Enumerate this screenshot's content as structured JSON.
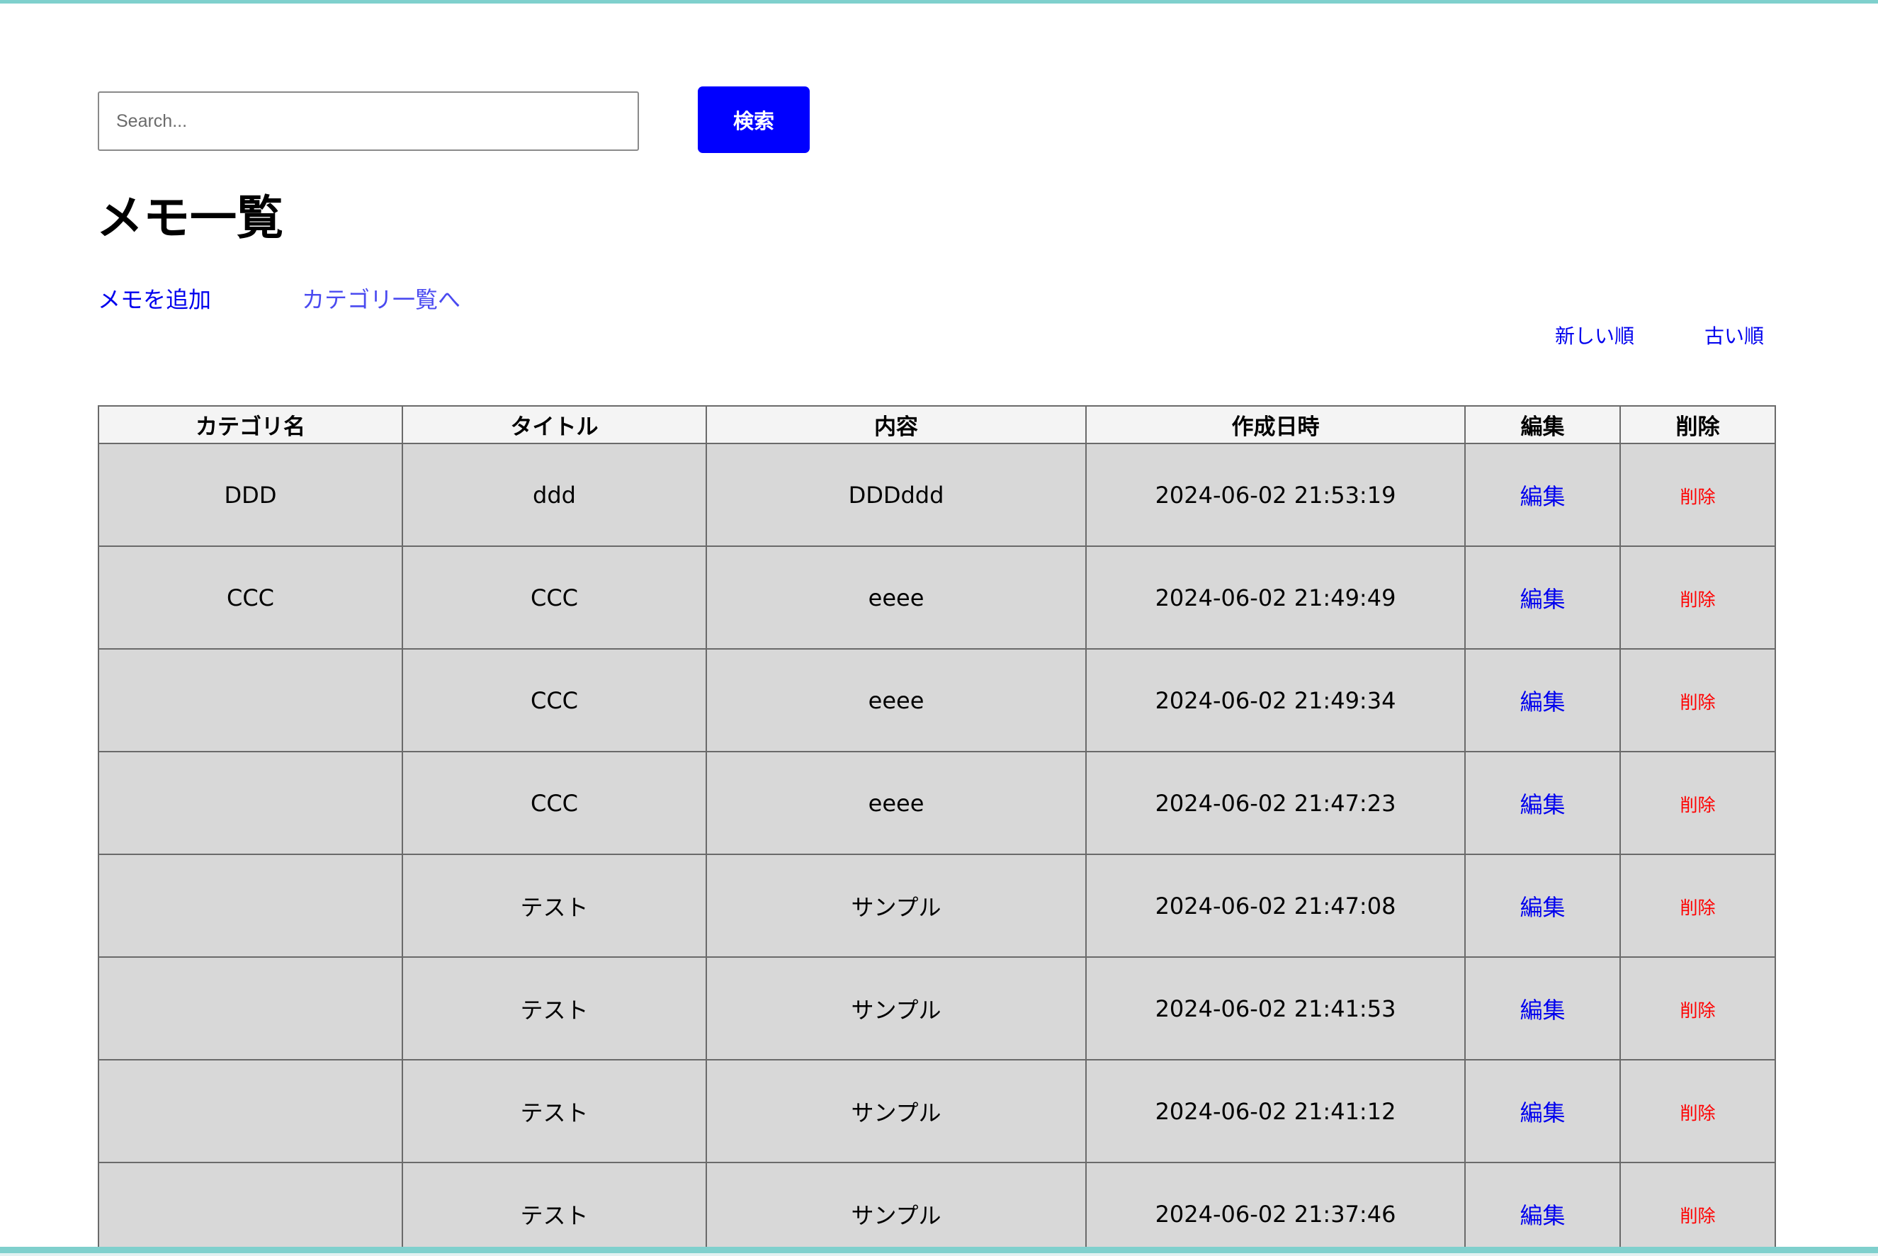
{
  "search": {
    "placeholder": "Search...",
    "value": "",
    "button_label": "検索"
  },
  "page_title": "メモ一覧",
  "nav": {
    "add_memo": "メモを追加",
    "category_list": "カテゴリ一覧へ"
  },
  "sort": {
    "newest": "新しい順",
    "oldest": "古い順"
  },
  "table": {
    "headers": [
      "カテゴリ名",
      "タイトル",
      "内容",
      "作成日時",
      "編集",
      "削除"
    ],
    "rows": [
      {
        "category": "DDD",
        "title": "ddd",
        "content": "DDDddd",
        "created_at": "2024-06-02 21:53:19",
        "edit": "編集",
        "delete": "削除"
      },
      {
        "category": "CCC",
        "title": "CCC",
        "content": "eeee",
        "created_at": "2024-06-02 21:49:49",
        "edit": "編集",
        "delete": "削除"
      },
      {
        "category": "",
        "title": "CCC",
        "content": "eeee",
        "created_at": "2024-06-02 21:49:34",
        "edit": "編集",
        "delete": "削除"
      },
      {
        "category": "",
        "title": "CCC",
        "content": "eeee",
        "created_at": "2024-06-02 21:47:23",
        "edit": "編集",
        "delete": "削除"
      },
      {
        "category": "",
        "title": "テスト",
        "content": "サンプル",
        "created_at": "2024-06-02 21:47:08",
        "edit": "編集",
        "delete": "削除"
      },
      {
        "category": "",
        "title": "テスト",
        "content": "サンプル",
        "created_at": "2024-06-02 21:41:53",
        "edit": "編集",
        "delete": "削除"
      },
      {
        "category": "",
        "title": "テスト",
        "content": "サンプル",
        "created_at": "2024-06-02 21:41:12",
        "edit": "編集",
        "delete": "削除"
      },
      {
        "category": "",
        "title": "テスト",
        "content": "サンプル",
        "created_at": "2024-06-02 21:37:46",
        "edit": "編集",
        "delete": "削除"
      }
    ]
  },
  "colors": {
    "accent_border": "#7fd0cd",
    "search_button": "#0000ff",
    "link": "#0000ee",
    "delete_link": "#ff0000",
    "row_background": "#d8d8d8",
    "header_background": "#f4f4f4"
  }
}
